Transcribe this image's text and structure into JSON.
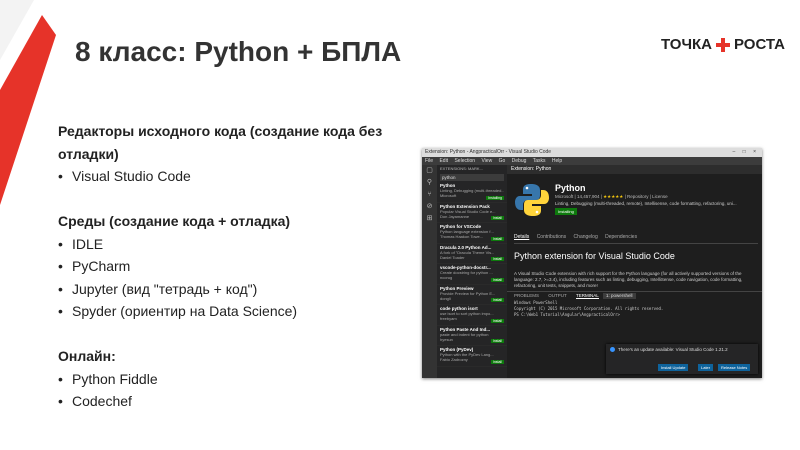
{
  "slide": {
    "title": "8 класс: Python + БПЛА",
    "logo_left": "ТОЧКА",
    "logo_right": "РОСТА"
  },
  "colors": {
    "accent": "#e63329",
    "vscode_bg": "#1e1e1e",
    "install": "#0e7a0d"
  },
  "sections": {
    "editors": {
      "heading": "Редакторы исходного кода (создание кода без отладки)",
      "items": [
        "Visual Studio Code"
      ]
    },
    "ides": {
      "heading": "Среды (создание кода + отладка)",
      "items": [
        "IDLE",
        "PyCharm",
        "Jupyter (вид \"тетрадь + код\")",
        "Spyder (ориентир на Data Science)"
      ]
    },
    "online": {
      "heading": "Онлайн:",
      "items": [
        "Python Fiddle",
        "Codechef"
      ]
    }
  },
  "screenshot": {
    "window_title": "Extension: Python - AngpracticalOrr - Visual Studio Code",
    "window_controls": "– □ ×",
    "menu": [
      "File",
      "Edit",
      "Selection",
      "View",
      "Go",
      "Debug",
      "Tasks",
      "Help"
    ],
    "activity_icons": [
      "files-icon",
      "search-icon",
      "source-control-icon",
      "debug-icon",
      "extensions-icon"
    ],
    "sidebar_header": "EXTENSIONS: MARK...",
    "search_value": "python",
    "extensions": [
      {
        "name": "Python",
        "desc": "Linting, Debugging (multi-threaded...)",
        "author": "Microsoft",
        "badge": "Installing"
      },
      {
        "name": "Python Extension Pack",
        "desc": "Popular Visual Studio Code e...",
        "author": "Don Jayamanne",
        "badge": "Install"
      },
      {
        "name": "Python for VSCode",
        "desc": "Python language extension f...",
        "author": "Thomas Haakon Towe...",
        "badge": "Install"
      },
      {
        "name": "Dracula 2.0 Python Ad...",
        "desc": "A fork of \"Dracula Theme Vis...",
        "author": "Daniel Toader",
        "badge": "Install"
      },
      {
        "name": "vscode-python-docstr...",
        "desc": "Create docstring for python ...",
        "author": "ncorug",
        "badge": "Install"
      },
      {
        "name": "Python Preview",
        "desc": "Provide Preview for Python E...",
        "author": "dongli",
        "badge": "Install"
      },
      {
        "name": "code python isort",
        "desc": "use isort to sort python impo...",
        "author": "freebyam",
        "badge": "Install"
      },
      {
        "name": "Python Paste And Ind...",
        "desc": "paste and indent for python",
        "author": "hyesun",
        "badge": "Install"
      },
      {
        "name": "Python (PyDev)",
        "desc": "Python with the PyDev Lang...",
        "author": "Fabio Zadrozny",
        "badge": "Install"
      }
    ],
    "tab_label": "Extension: Python",
    "ext_title": "Python",
    "ext_id": "ms-python.python",
    "ext_publisher": "Microsoft",
    "ext_installs": "14,457,904",
    "ext_stars": "★★★★★",
    "ext_links": "Repository | License",
    "ext_desc": "Linting, Debugging (multi-threaded, remote), Intellisense, code formatting, refactoring, uni...",
    "ext_install_label": "Installing",
    "detail_tabs": [
      "Details",
      "Contributions",
      "Changelog",
      "Dependencies"
    ],
    "heading": "Python extension for Visual Studio Code",
    "paragraph": "A Visual Studio Code extension with rich support for the Python language (for all actively supported versions of the language: 2.7, >=3.4), including features such as linting, debugging, IntelliSense, code navigation, code formatting, refactoring, unit tests, snippets, and more!",
    "terminal_tabs": [
      "PROBLEMS",
      "OUTPUT",
      "TERMINAL",
      "..."
    ],
    "terminal_select": "1: powershell",
    "terminal_lines": [
      "Windows PowerShell",
      "Copyright (C) 2015 Microsoft Corporation. All rights reserved.",
      "",
      "PS C:\\Web1 Tutorial\\Angular\\AngpracticalOrr>"
    ],
    "notification": "There's an update available: Visual Studio Code 1.21.2",
    "notif_buttons": [
      "Install Update",
      "Later",
      "Release Notes"
    ]
  }
}
